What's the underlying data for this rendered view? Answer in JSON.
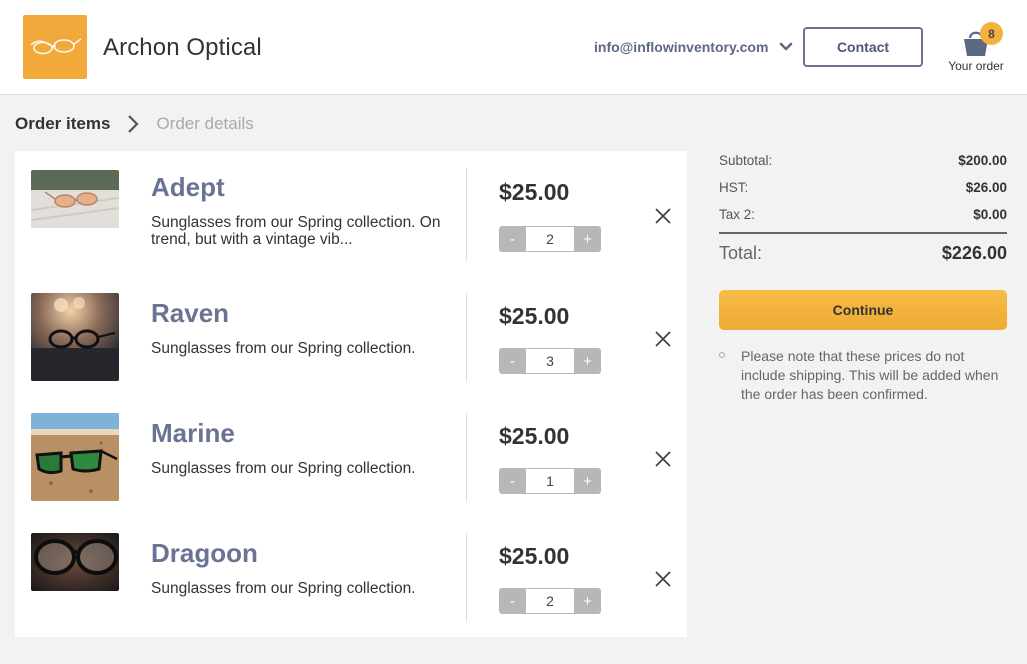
{
  "header": {
    "brand": "Archon Optical",
    "email": "info@inflowinventory.com",
    "contact_label": "Contact",
    "cart_count": "8",
    "cart_label": "Your order"
  },
  "breadcrumb": {
    "active": "Order items",
    "inactive": "Order details"
  },
  "items": [
    {
      "name": "Adept",
      "description": "Sunglasses from our Spring collection. On trend, but with a vintage vib...",
      "price": "$25.00",
      "quantity": "2",
      "minus": "-",
      "plus": "+"
    },
    {
      "name": "Raven",
      "description": "Sunglasses from our Spring collection.",
      "price": "$25.00",
      "quantity": "3",
      "minus": "-",
      "plus": "+"
    },
    {
      "name": "Marine",
      "description": "Sunglasses from our Spring collection.",
      "price": "$25.00",
      "quantity": "1",
      "minus": "-",
      "plus": "+"
    },
    {
      "name": "Dragoon",
      "description": "Sunglasses from our Spring collection.",
      "price": "$25.00",
      "quantity": "2",
      "minus": "-",
      "plus": "+"
    }
  ],
  "summary": {
    "subtotal_label": "Subtotal:",
    "subtotal_value": "$200.00",
    "hst_label": "HST:",
    "hst_value": "$26.00",
    "tax2_label": "Tax 2:",
    "tax2_value": "$0.00",
    "total_label": "Total:",
    "total_value": "$226.00",
    "continue_label": "Continue",
    "note": "Please note that these prices do not include shipping. This will be added when the order has been confirmed."
  },
  "colors": {
    "accent": "#f0a93a",
    "product_name": "#6a7391",
    "contact_border": "#6a7391"
  }
}
